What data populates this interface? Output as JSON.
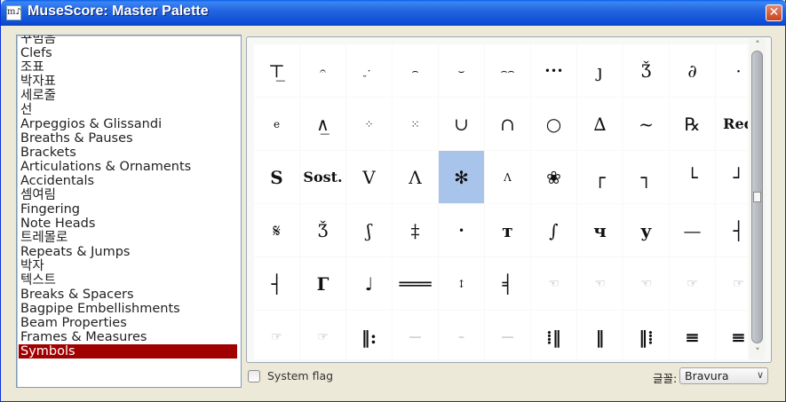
{
  "window": {
    "title": "MuseScore: Master Palette",
    "app_icon": "m♪",
    "close_glyph": "✕"
  },
  "categories": [
    {
      "label": "꾸밈음",
      "selected": false
    },
    {
      "label": "Clefs",
      "selected": false
    },
    {
      "label": "조표",
      "selected": false
    },
    {
      "label": "박자표",
      "selected": false
    },
    {
      "label": "세로줄",
      "selected": false
    },
    {
      "label": "선",
      "selected": false
    },
    {
      "label": "Arpeggios & Glissandi",
      "selected": false
    },
    {
      "label": "Breaths & Pauses",
      "selected": false
    },
    {
      "label": "Brackets",
      "selected": false
    },
    {
      "label": "Articulations & Ornaments",
      "selected": false
    },
    {
      "label": "Accidentals",
      "selected": false
    },
    {
      "label": "셈여림",
      "selected": false
    },
    {
      "label": "Fingering",
      "selected": false
    },
    {
      "label": "Note Heads",
      "selected": false
    },
    {
      "label": "트레몰로",
      "selected": false
    },
    {
      "label": "Repeats & Jumps",
      "selected": false
    },
    {
      "label": "박자",
      "selected": false
    },
    {
      "label": "텍스트",
      "selected": false
    },
    {
      "label": "Breaks & Spacers",
      "selected": false
    },
    {
      "label": "Bagpipe Embellishments",
      "selected": false
    },
    {
      "label": "Beam Properties",
      "selected": false
    },
    {
      "label": "Frames & Measures",
      "selected": false
    },
    {
      "label": "Symbols",
      "selected": true
    }
  ],
  "symbols": [
    [
      {
        "glyph": "⊤̲",
        "icon": "fermata-bracket-icon"
      },
      {
        "glyph": "𝄐",
        "icon": "fermata-short-icon",
        "cls": "small"
      },
      {
        "glyph": "̮·",
        "icon": "fermata-below-icon",
        "cls": "small"
      },
      {
        "glyph": "⌢",
        "icon": "fermata-icon",
        "cls": "small"
      },
      {
        "glyph": "⌣",
        "icon": "fermata-below-long-icon",
        "cls": "small"
      },
      {
        "glyph": "⌢⌢",
        "icon": "fermata-long-icon",
        "cls": "small"
      },
      {
        "glyph": "•••",
        "icon": "fermata-dots-icon",
        "cls": "small"
      },
      {
        "glyph": "ȷ",
        "icon": "breath-mark-icon"
      },
      {
        "glyph": "Ǯ",
        "icon": "turn-symbol-icon"
      },
      {
        "glyph": "∂",
        "icon": "breath-comma-icon"
      },
      {
        "glyph": "·",
        "icon": "staccato-dot-icon"
      }
    ],
    [
      {
        "glyph": "е",
        "icon": "pedal-e-icon",
        "cls": "small"
      },
      {
        "glyph": "∧̲",
        "icon": "marcato-line-icon"
      },
      {
        "glyph": "⁘",
        "icon": "ornament-dots-icon",
        "cls": "small"
      },
      {
        "glyph": "⁙",
        "icon": "ornament-star-icon",
        "cls": "small"
      },
      {
        "glyph": "∪",
        "icon": "cup-icon"
      },
      {
        "glyph": "∩",
        "icon": "cap-icon"
      },
      {
        "glyph": "○",
        "icon": "circle-icon"
      },
      {
        "glyph": "∆",
        "icon": "mordent-upper-icon"
      },
      {
        "glyph": "~",
        "icon": "tilde-icon"
      },
      {
        "glyph": "℞",
        "icon": "pedal-r-icon"
      },
      {
        "glyph": "Red",
        "icon": "pedal-red-icon",
        "cls": "text"
      }
    ],
    [
      {
        "glyph": "Ѕ",
        "icon": "pedal-s-icon",
        "cls": "bold"
      },
      {
        "glyph": "Sost.",
        "icon": "sostenuto-icon",
        "cls": "text"
      },
      {
        "glyph": "V",
        "icon": "bow-up-icon"
      },
      {
        "glyph": "Λ",
        "icon": "bow-down-icon"
      },
      {
        "glyph": "✻",
        "icon": "pedal-release-icon",
        "selected": true
      },
      {
        "glyph": "Λ",
        "icon": "marcato-small-icon",
        "cls": "small"
      },
      {
        "glyph": "❀",
        "icon": "pedal-flower-icon"
      },
      {
        "glyph": "┌",
        "icon": "bracket-top-left-icon"
      },
      {
        "glyph": "┐",
        "icon": "bracket-top-right-icon"
      },
      {
        "glyph": "└",
        "icon": "bracket-bottom-left-icon"
      },
      {
        "glyph": "┘",
        "icon": "bracket-bottom-right-icon"
      }
    ],
    [
      {
        "glyph": "𝄋",
        "icon": "segno-icon"
      },
      {
        "glyph": "Ǯ",
        "icon": "turn-alt-icon"
      },
      {
        "glyph": "ʃ",
        "icon": "mordent-icon"
      },
      {
        "glyph": "‡",
        "icon": "double-dagger-icon"
      },
      {
        "glyph": "•",
        "icon": "dot-icon",
        "cls": "small"
      },
      {
        "glyph": "т",
        "icon": "flag-icon",
        "cls": "bold"
      },
      {
        "glyph": "∫",
        "icon": "integral-icon"
      },
      {
        "glyph": "ч",
        "icon": "flag-alt-icon",
        "cls": "bold"
      },
      {
        "glyph": "у",
        "icon": "flag-u-icon",
        "cls": "bold"
      },
      {
        "glyph": "—",
        "icon": "dash-icon"
      },
      {
        "glyph": "┤",
        "icon": "tee-left-icon"
      }
    ],
    [
      {
        "glyph": "┤",
        "icon": "tee-bold-icon",
        "cls": "bold"
      },
      {
        "glyph": "Г",
        "icon": "rest-icon",
        "cls": "bold"
      },
      {
        "glyph": "♩",
        "icon": "note-icon"
      },
      {
        "glyph": "═══",
        "icon": "double-bar-icon",
        "cls": "bold"
      },
      {
        "glyph": "↕",
        "icon": "arrow-vertical-icon",
        "cls": "small"
      },
      {
        "glyph": "╡",
        "icon": "repeat-left-icon",
        "cls": "bold"
      },
      {
        "glyph": "☜",
        "icon": "hand-pointing-left-icon",
        "cls": "faint"
      },
      {
        "glyph": "☜",
        "icon": "hand-pointing-left-alt-icon",
        "cls": "faint"
      },
      {
        "glyph": "☜",
        "icon": "hand-fist-icon",
        "cls": "faint"
      },
      {
        "glyph": "☞",
        "icon": "hand-pointing-right-icon",
        "cls": "faint"
      },
      {
        "glyph": "☞",
        "icon": "hand-pointing-right-alt-icon",
        "cls": "faint"
      }
    ],
    [
      {
        "glyph": "☞",
        "icon": "hand-right-faint-icon",
        "cls": "faint"
      },
      {
        "glyph": "☞",
        "icon": "hand-pointing-icon",
        "cls": "faint"
      },
      {
        "glyph": "‖:",
        "icon": "repeat-start-icon",
        "cls": "bold"
      },
      {
        "glyph": "—",
        "icon": "line-faint-icon",
        "cls": "faint"
      },
      {
        "glyph": "–",
        "icon": "short-line-faint-icon",
        "cls": "faint"
      },
      {
        "glyph": "—",
        "icon": "long-line-faint-icon",
        "cls": "faint"
      },
      {
        "glyph": "⁞‖",
        "icon": "repeat-end-icon",
        "cls": "bold"
      },
      {
        "glyph": "‖",
        "icon": "final-barline-icon",
        "cls": "bold"
      },
      {
        "glyph": "‖⁞",
        "icon": "repeat-dots-icon",
        "cls": "bold"
      },
      {
        "glyph": "≡",
        "icon": "tremolo-icon",
        "cls": "bold"
      },
      {
        "glyph": "≡",
        "icon": "tremolo-alt-icon",
        "cls": "bold"
      }
    ]
  ],
  "scrollbar": {
    "up_arrow": "˄",
    "down_arrow": "˅",
    "up_icon": "scroll-up-arrow-icon",
    "down_icon": "scroll-down-arrow-icon"
  },
  "options": {
    "system_flag_label": "System flag",
    "system_flag_checked": false,
    "font_label": "글꼴:",
    "font_value": "Bravura",
    "dropdown_arrow": "∨"
  },
  "colors": {
    "selected_category": "#a00000",
    "selected_cell": "#a9c4eb",
    "titlebar": "#2466df"
  }
}
